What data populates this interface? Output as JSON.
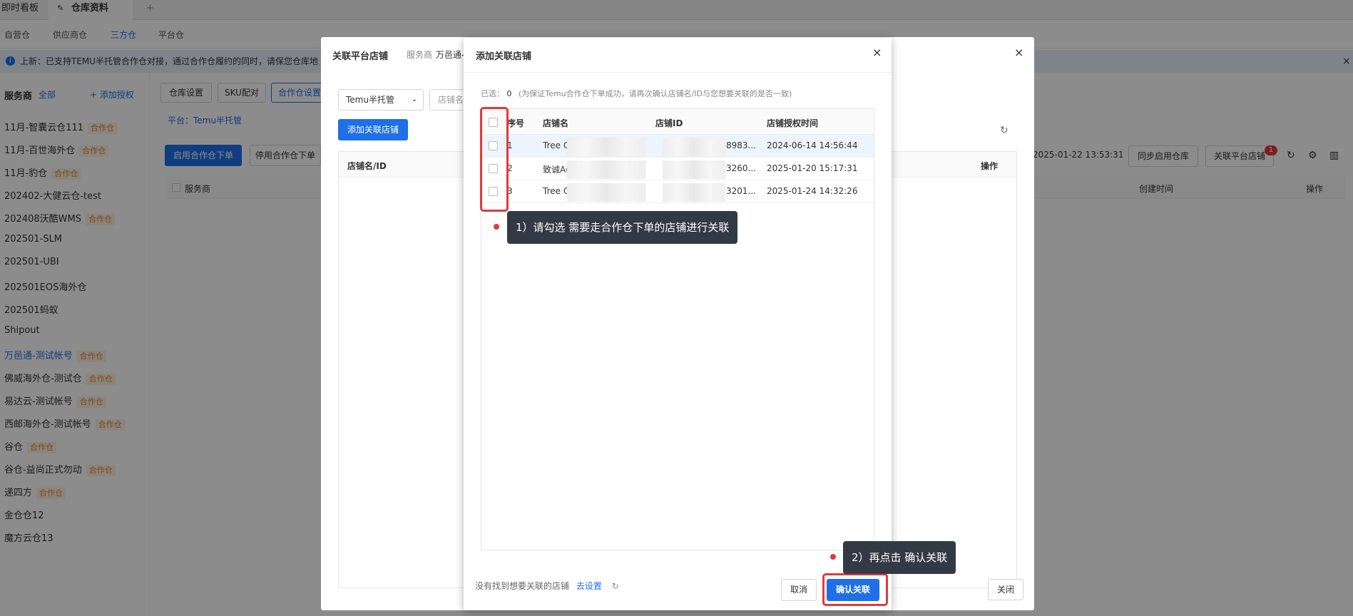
{
  "tabs": [
    {
      "label": "即时看板"
    },
    {
      "label": "仓库资料"
    }
  ],
  "tab_add": "+",
  "subnav": [
    "自营仓",
    "供应商仓",
    "三方仓",
    "平台仓"
  ],
  "notice": "上新：已支持TEMU半托管合作仓对接，通过合作仓履约的同时，请保您仓库地",
  "sidebar": {
    "title": "服务商",
    "filter": "全部",
    "add_auth": "添加授权",
    "items": [
      {
        "label": "11月-智囊云仓111",
        "tag": "合作仓"
      },
      {
        "label": "11月-百世海外仓",
        "tag": "合作仓"
      },
      {
        "label": "11月-豹仓",
        "tag": "合作仓"
      },
      {
        "label": "202402-大健云仓-test",
        "tag": ""
      },
      {
        "label": "202408沃酷WMS",
        "tag": "合作仓"
      },
      {
        "label": "202501-SLM",
        "tag": ""
      },
      {
        "label": "202501-UBI",
        "tag": ""
      },
      {
        "label": "202501EOS海外仓",
        "tag": ""
      },
      {
        "label": "202501蚂蚁",
        "tag": ""
      },
      {
        "label": "Shipout",
        "tag": ""
      },
      {
        "label": "万邑通-测试帐号",
        "tag": "合作仓"
      },
      {
        "label": "佛威海外仓-测试仓",
        "tag": "合作仓"
      },
      {
        "label": "易达云-测试帐号",
        "tag": "合作仓"
      },
      {
        "label": "西邮海外仓-测试帐号",
        "tag": "合作仓"
      },
      {
        "label": "谷仓",
        "tag": "合作仓"
      },
      {
        "label": "谷仓-益尚正式勿动",
        "tag": "合作仓"
      },
      {
        "label": "递四方",
        "tag": "合作仓"
      },
      {
        "label": "金仓仓12",
        "tag": ""
      },
      {
        "label": "魔方云仓13",
        "tag": ""
      }
    ]
  },
  "bg_tabs": [
    "仓库设置",
    "SKU配对",
    "合作仓设置"
  ],
  "bg_platform": "平台：Temu半托管",
  "bg_enable": "启用合作仓下单",
  "bg_disable": "停用合作仓下单",
  "bg_col_provider": "服务商",
  "bg_time": "2025-01-22 13:53:31",
  "bg_sync": "同步启用仓库",
  "bg_link": "关联平台店铺",
  "bg_badge": "1",
  "bg_created": "创建时间",
  "bg_op": "操作",
  "modal1": {
    "title": "关联平台店铺",
    "provider_label": "服务商",
    "provider_value": "万邑通-",
    "close": "×",
    "platform_select": "Temu半托管",
    "shop_filter": "店铺名",
    "add_button": "添加关联店铺",
    "col_shop": "店铺名/ID",
    "col_op": "操作",
    "footer_close": "关闭"
  },
  "modal2": {
    "title": "添加关联店铺",
    "close": "×",
    "selected_label": "已选：",
    "selected_count": "0",
    "selected_hint": "(为保证Temu合作仓下单成功，请再次确认店铺名/ID与您想要关联的是否一致)",
    "columns": {
      "index": "序号",
      "name": "店铺名",
      "id": "店铺ID",
      "time": "店铺授权时间"
    },
    "rows": [
      {
        "index": "1",
        "name": "Tree C",
        "id": "8983...",
        "time": "2024-06-14 14:56:44"
      },
      {
        "index": "2",
        "name": "致诚A(",
        "id": "3260...",
        "time": "2025-01-20 15:17:31"
      },
      {
        "index": "3",
        "name": "Tree C",
        "id": "3201...",
        "time": "2025-01-24 14:32:26"
      }
    ],
    "footer_hint": "没有找到想要关联的店铺",
    "footer_link": "去设置",
    "cancel": "取消",
    "confirm": "确认关联"
  },
  "annotations": {
    "step1": "1）请勾选 需要走合作仓下单的店铺进行关联",
    "step2": "2）再点击 确认关联"
  },
  "colors": {
    "primary": "#1e6fe8",
    "annotation_red": "#e5383b",
    "tag_orange": "#e5832d"
  }
}
